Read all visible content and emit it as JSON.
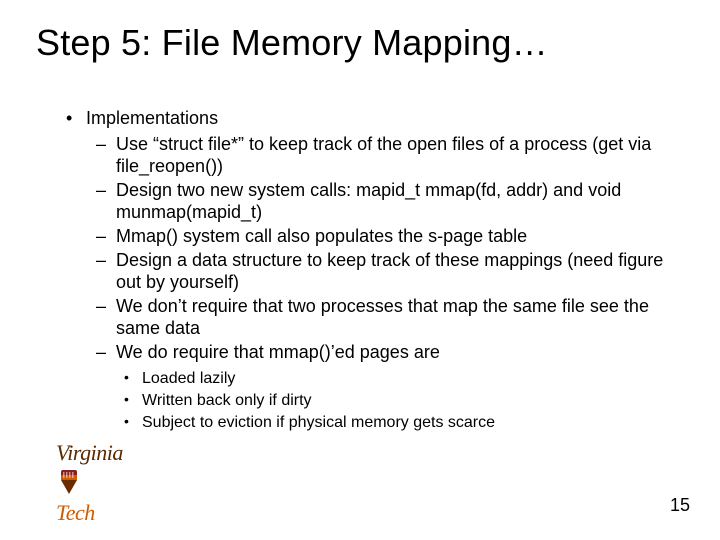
{
  "title": "Step 5: File Memory Mapping…",
  "heading1": "Implementations",
  "items": [
    "Use “struct file*” to keep track of the open files of a process (get via file_reopen())",
    "Design two new system calls: mapid_t mmap(fd, addr) and void munmap(mapid_t)",
    "Mmap() system call also populates the s-page table",
    "Design a data structure to keep track of these mappings (need figure out by yourself)",
    "We don’t require that two processes that map the same file see the same data",
    "We do require that mmap()’ed pages are"
  ],
  "sub": [
    "Loaded lazily",
    "Written back only if dirty",
    "Subject to eviction if physical memory gets scarce"
  ],
  "page_number": "15",
  "logo": {
    "part1": "Virginia",
    "part2": "Tech"
  }
}
